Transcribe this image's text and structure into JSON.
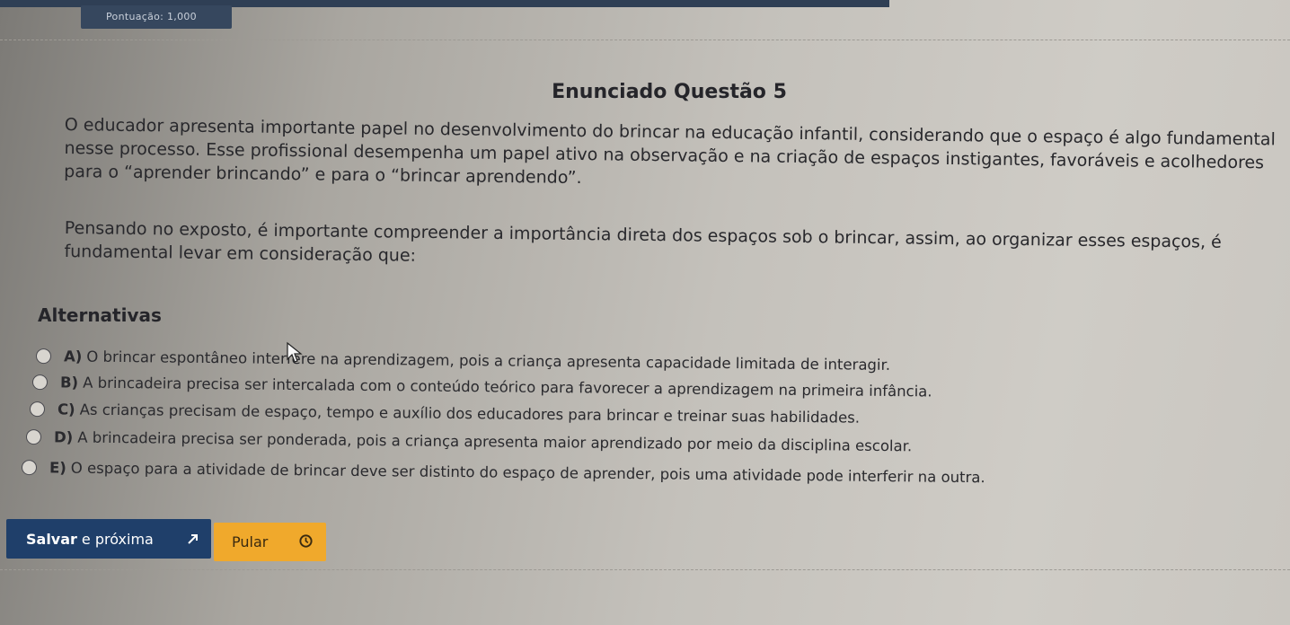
{
  "header": {
    "score_label": "Pontuação: 1,000"
  },
  "question": {
    "title": "Enunciado Questão 5",
    "paragraphs": [
      "O educador apresenta importante papel no desenvolvimento do brincar na educação infantil, considerando que o espaço é algo fundamental nesse processo. Esse profissional desempenha um papel ativo na observação e na criação de espaços instigantes, favoráveis e acolhedores para o “aprender brincando” e para o “brincar aprendendo”.",
      "Pensando no exposto, é importante compreender a importância direta dos espaços sob o brincar, assim, ao organizar esses espaços, é fundamental levar em consideração que:"
    ]
  },
  "alternatives": {
    "heading": "Alternativas",
    "options": [
      {
        "letter": "A)",
        "text": "O brincar espontâneo interfere na aprendizagem, pois a criança apresenta capacidade limitada de interagir."
      },
      {
        "letter": "B)",
        "text": "A brincadeira precisa ser intercalada com o conteúdo teórico para favorecer a aprendizagem na primeira infância."
      },
      {
        "letter": "C)",
        "text": "As crianças precisam de espaço, tempo e auxílio dos educadores para brincar e treinar suas habilidades."
      },
      {
        "letter": "D)",
        "text": "A brincadeira precisa ser ponderada, pois a criança apresenta maior aprendizado por meio da disciplina escolar."
      },
      {
        "letter": "E)",
        "text": "O espaço para a atividade de brincar deve ser distinto do espaço de aprender, pois uma atividade pode interferir na outra."
      }
    ]
  },
  "actions": {
    "save_bold": "Salvar",
    "save_rest": "e próxima",
    "skip_label": "Pular"
  },
  "colors": {
    "save_button": "#1f3f6a",
    "skip_button": "#f0a92c",
    "score_badge": "#36475e"
  }
}
